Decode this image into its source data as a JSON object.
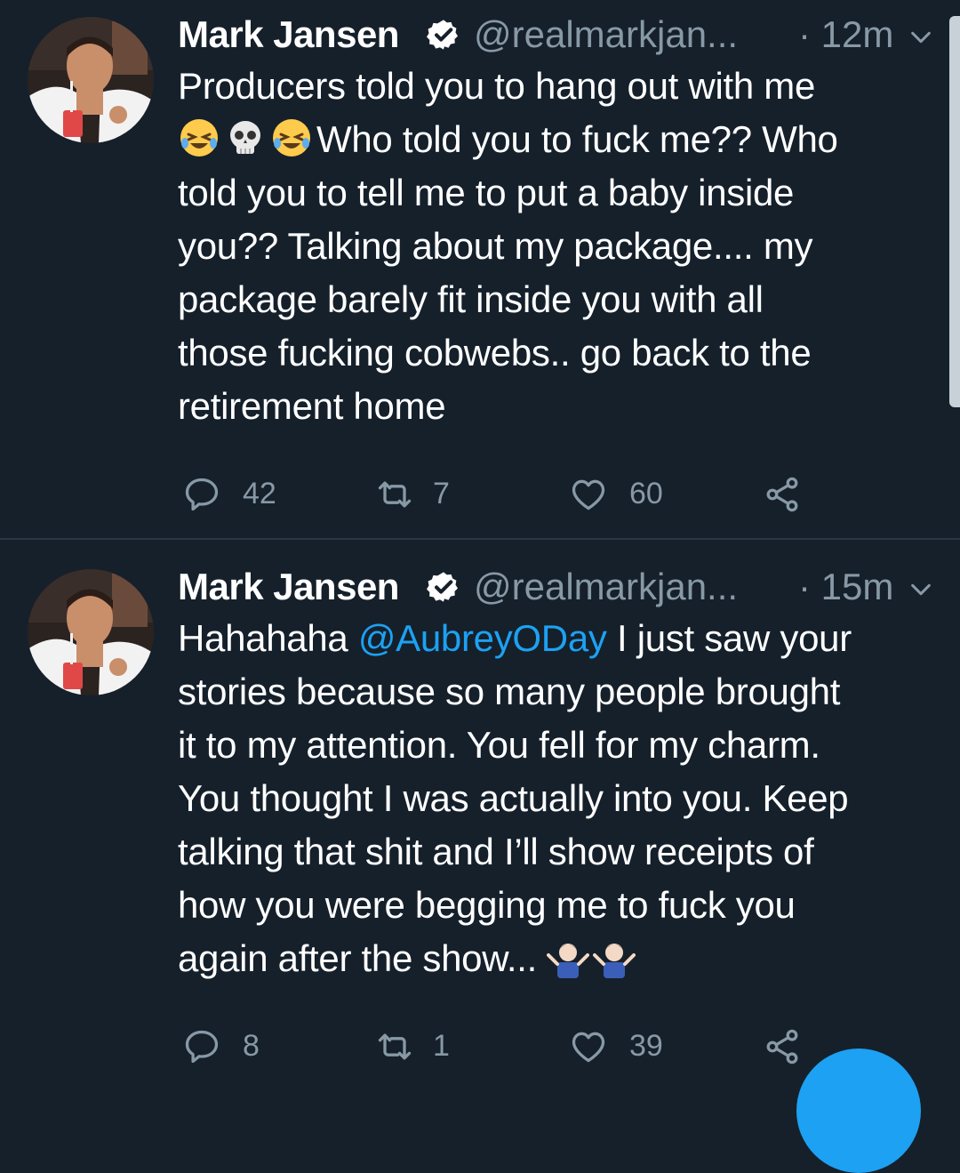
{
  "theme": {
    "background": "#15202b",
    "text": "#ffffff",
    "muted": "#8899a6",
    "accent": "#1da1f2",
    "divider": "#2a3744"
  },
  "tweets": [
    {
      "author_name": "Mark Jansen",
      "handle": "@realmarkjan...",
      "time": "· 12m",
      "verified": true,
      "body_lines": [
        "Producers told you to hang out with me",
        "Who told you to fuck me?? Who",
        "told you to tell me to put a baby inside",
        "you?? Talking about my package.... my",
        "package barely fit inside you with all",
        "those fucking cobwebs.. go back to the",
        "retirement home"
      ],
      "emojis_line2": [
        "rolling-on-floor-laughing",
        "skull",
        "rolling-on-floor-laughing"
      ],
      "replies": "42",
      "retweets": "7",
      "likes": "60"
    },
    {
      "author_name": "Mark Jansen",
      "handle": "@realmarkjan...",
      "time": "· 15m",
      "verified": true,
      "body_prefix": "Hahahaha ",
      "mention": "@AubreyODay",
      "body_line1_rest": " I just saw your",
      "body_lines": [
        "stories because so many people brought",
        "it to my attention. You fell for my charm.",
        "You thought I was actually into you. Keep",
        "talking that shit and I’ll show receipts of",
        "how you were begging me to fuck you",
        "again after the show..."
      ],
      "emojis_end": [
        "man-shrugging",
        "man-shrugging"
      ],
      "replies": "8",
      "retweets": "1",
      "likes": "39"
    }
  ]
}
